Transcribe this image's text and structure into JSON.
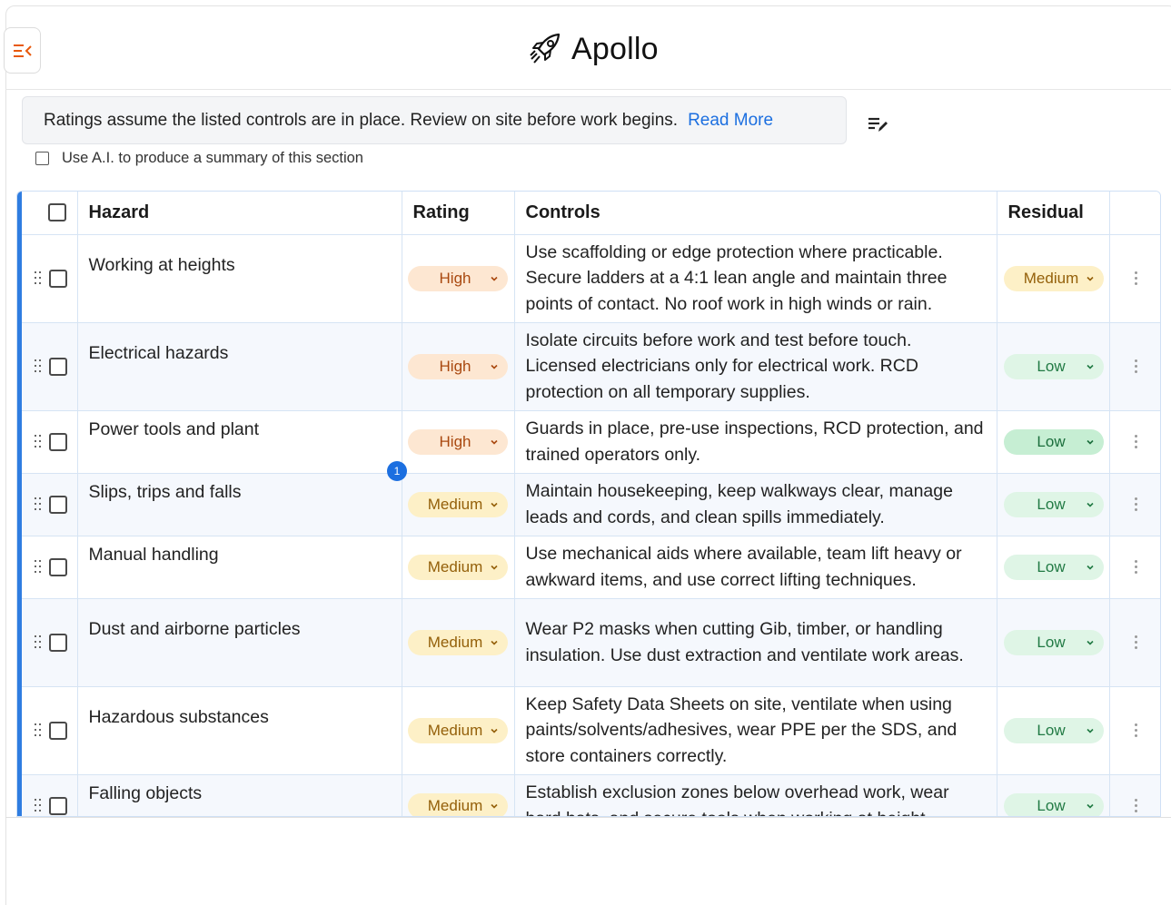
{
  "app": {
    "title": "Apollo",
    "logo_icon": "rocket-icon",
    "sidebar_toggle_icon": "collapse-sidebar-icon",
    "accent_color": "#e8590c"
  },
  "notice": {
    "text": "Ratings assume the listed controls are in place. Review on site before work begins.",
    "link_label": "Read More",
    "edit_icon": "edit-list-icon"
  },
  "ai_option": {
    "label": "Use A.I. to produce a summary of this section",
    "checked": false
  },
  "table": {
    "columns": [
      "Hazard",
      "Rating",
      "Controls",
      "Residual"
    ],
    "badge_count": "1",
    "rows": [
      {
        "hazard": "Working at heights",
        "rating": "High",
        "controls": "Use scaffolding or edge protection where practicable. Secure ladders at a 4:1 lean angle and maintain three points of contact. No roof work in high winds or rain.",
        "residual": "Medium"
      },
      {
        "hazard": "Electrical hazards",
        "rating": "High",
        "controls": "Isolate circuits before work and test before touch. Licensed electricians only for electrical work. RCD protection on all temporary supplies.",
        "residual": "Low"
      },
      {
        "hazard": "Power tools and plant",
        "rating": "High",
        "controls": "Guards in place, pre-use inspections, RCD protection, and trained operators only.",
        "residual": "Low"
      },
      {
        "hazard": "Slips, trips and falls",
        "rating": "Medium",
        "controls": "Maintain housekeeping, keep walkways clear, manage leads and cords, and clean spills immediately.",
        "residual": "Low"
      },
      {
        "hazard": "Manual handling",
        "rating": "Medium",
        "controls": "Use mechanical aids where available, team lift heavy or awkward items, and use correct lifting techniques.",
        "residual": "Low"
      },
      {
        "hazard": "Dust and airborne particles",
        "rating": "Medium",
        "controls": "Wear P2 masks when cutting Gib, timber, or handling insulation. Use dust extraction and ventilate work areas.",
        "residual": "Low"
      },
      {
        "hazard": "Hazardous substances",
        "rating": "Medium",
        "controls": "Keep Safety Data Sheets on site, ventilate when using paints/solvents/adhesives, wear PPE per the SDS, and store containers correctly.",
        "residual": "Low"
      },
      {
        "hazard": "Falling objects",
        "rating": "Medium",
        "controls": "Establish exclusion zones below overhead work, wear hard hats, and secure tools when working at height.",
        "residual": "Low"
      }
    ]
  }
}
